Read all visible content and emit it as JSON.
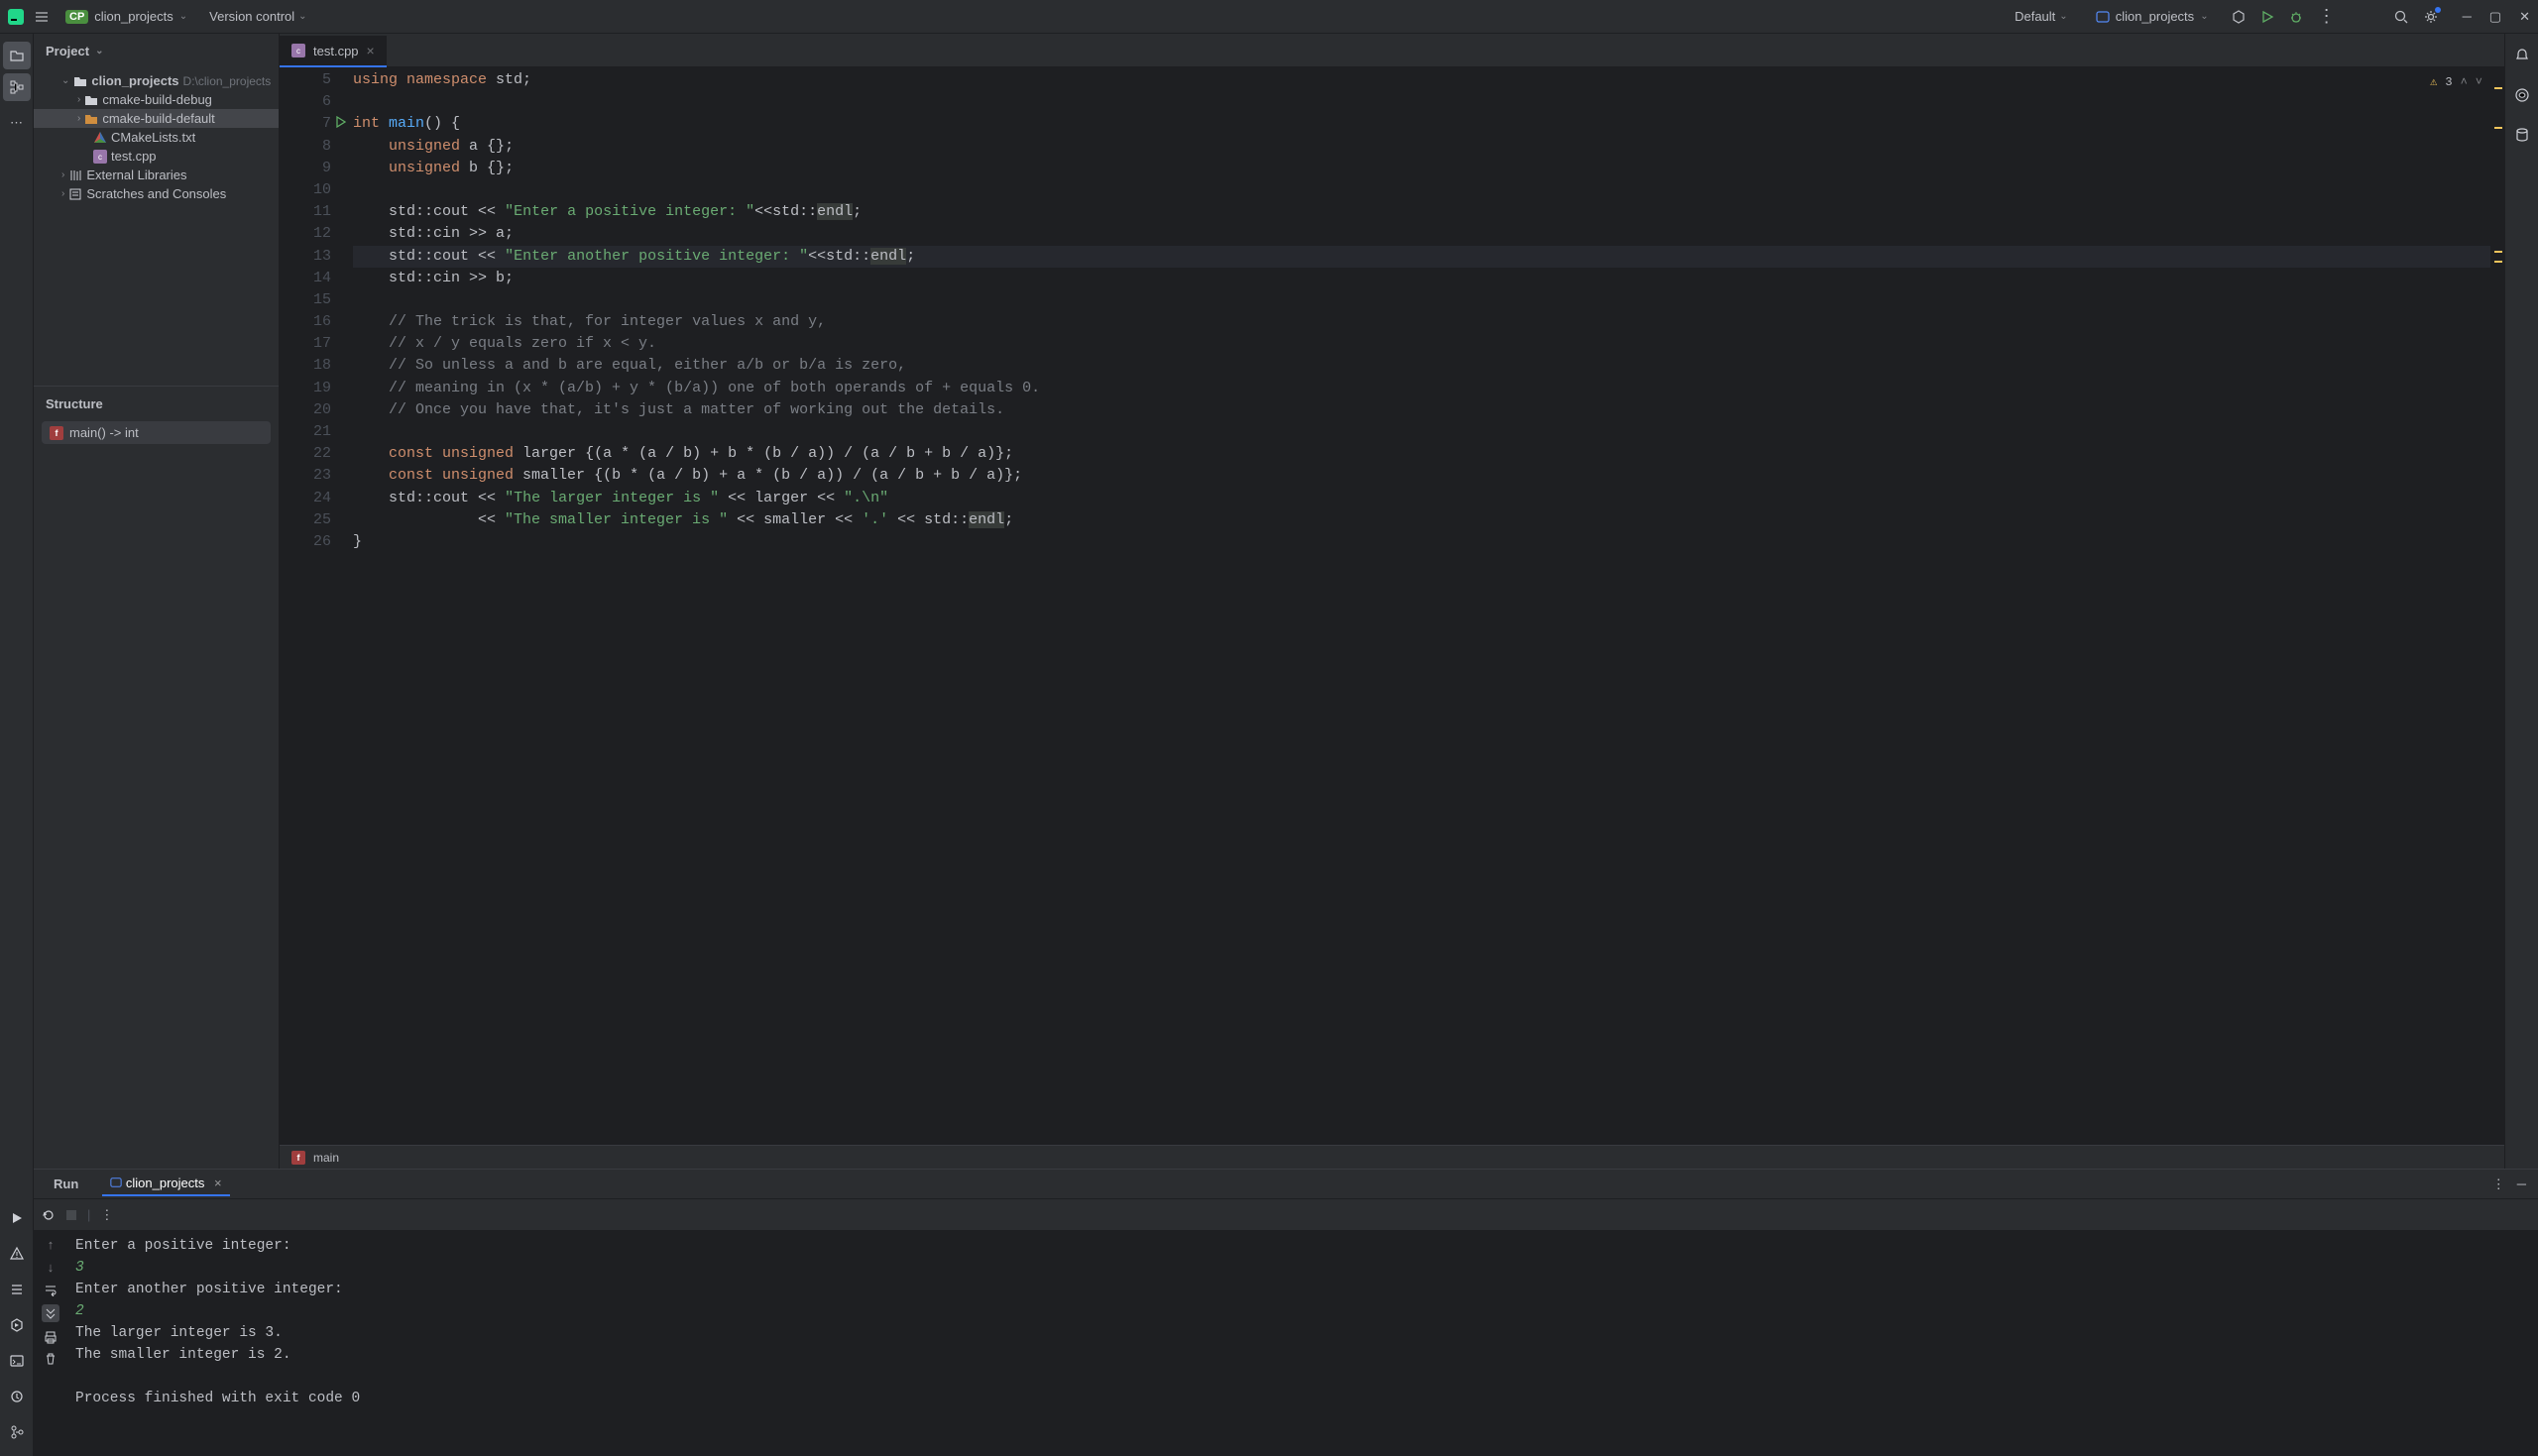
{
  "titlebar": {
    "project_name": "clion_projects",
    "vcs_label": "Version control",
    "default_label": "Default",
    "run_config": "clion_projects"
  },
  "sidebar": {
    "header": "Project",
    "root": {
      "name": "clion_projects",
      "path": "D:\\clion_projects"
    },
    "children": [
      {
        "name": "cmake-build-debug"
      },
      {
        "name": "cmake-build-default"
      },
      {
        "name": "CMakeLists.txt"
      },
      {
        "name": "test.cpp"
      }
    ],
    "external": "External Libraries",
    "scratches": "Scratches and Consoles"
  },
  "structure": {
    "header": "Structure",
    "item": "main() -> int"
  },
  "tabs": {
    "active": "test.cpp"
  },
  "inspection": {
    "warnings": "3"
  },
  "code_lines": [
    {
      "n": 5,
      "seg": [
        {
          "t": "using ",
          "c": "kw"
        },
        {
          "t": "namespace ",
          "c": "kw"
        },
        {
          "t": "std",
          "c": ""
        },
        {
          "t": ";",
          "c": ""
        }
      ]
    },
    {
      "n": 6,
      "seg": []
    },
    {
      "n": 7,
      "run": true,
      "seg": [
        {
          "t": "int ",
          "c": "kw"
        },
        {
          "t": "main",
          "c": "fn"
        },
        {
          "t": "() {",
          "c": ""
        }
      ]
    },
    {
      "n": 8,
      "seg": [
        {
          "t": "    ",
          "c": ""
        },
        {
          "t": "unsigned ",
          "c": "kw"
        },
        {
          "t": "a ",
          "c": ""
        },
        {
          "t": "{}",
          "c": ""
        },
        {
          "t": ";",
          "c": ""
        }
      ]
    },
    {
      "n": 9,
      "seg": [
        {
          "t": "    ",
          "c": ""
        },
        {
          "t": "unsigned ",
          "c": "kw"
        },
        {
          "t": "b ",
          "c": ""
        },
        {
          "t": "{}",
          "c": ""
        },
        {
          "t": ";",
          "c": ""
        }
      ]
    },
    {
      "n": 10,
      "seg": []
    },
    {
      "n": 11,
      "seg": [
        {
          "t": "    ",
          "c": ""
        },
        {
          "t": "std",
          "c": "ns"
        },
        {
          "t": "::",
          "c": ""
        },
        {
          "t": "cout << ",
          "c": ""
        },
        {
          "t": "\"Enter a positive integer: \"",
          "c": "str"
        },
        {
          "t": "<<",
          "c": ""
        },
        {
          "t": "std",
          "c": "ns"
        },
        {
          "t": "::",
          "c": ""
        },
        {
          "t": "endl",
          "c": "",
          "hl": true
        },
        {
          "t": ";",
          "c": ""
        }
      ]
    },
    {
      "n": 12,
      "seg": [
        {
          "t": "    ",
          "c": ""
        },
        {
          "t": "std",
          "c": "ns"
        },
        {
          "t": "::",
          "c": ""
        },
        {
          "t": "cin >> a;",
          "c": ""
        }
      ]
    },
    {
      "n": 13,
      "hl": true,
      "seg": [
        {
          "t": "    ",
          "c": ""
        },
        {
          "t": "std",
          "c": "ns"
        },
        {
          "t": "::",
          "c": ""
        },
        {
          "t": "cout << ",
          "c": ""
        },
        {
          "t": "\"Enter another positive integer: \"",
          "c": "str"
        },
        {
          "t": "<<",
          "c": ""
        },
        {
          "t": "std",
          "c": "ns"
        },
        {
          "t": "::",
          "c": ""
        },
        {
          "t": "endl",
          "c": "",
          "hl": true
        },
        {
          "t": ";",
          "c": ""
        }
      ]
    },
    {
      "n": 14,
      "seg": [
        {
          "t": "    ",
          "c": ""
        },
        {
          "t": "std",
          "c": "ns"
        },
        {
          "t": "::",
          "c": ""
        },
        {
          "t": "cin >> b;",
          "c": ""
        }
      ]
    },
    {
      "n": 15,
      "seg": []
    },
    {
      "n": 16,
      "seg": [
        {
          "t": "    ",
          "c": ""
        },
        {
          "t": "// The trick is that, for integer values x and y,",
          "c": "cmt"
        }
      ]
    },
    {
      "n": 17,
      "seg": [
        {
          "t": "    ",
          "c": ""
        },
        {
          "t": "// x / y equals zero if x < y.",
          "c": "cmt"
        }
      ]
    },
    {
      "n": 18,
      "seg": [
        {
          "t": "    ",
          "c": ""
        },
        {
          "t": "// So unless a and b are equal, either a/b or b/a is zero,",
          "c": "cmt"
        }
      ]
    },
    {
      "n": 19,
      "seg": [
        {
          "t": "    ",
          "c": ""
        },
        {
          "t": "// meaning in (x * (a/b) + y * (b/a)) one of both operands of + equals 0.",
          "c": "cmt"
        }
      ]
    },
    {
      "n": 20,
      "seg": [
        {
          "t": "    ",
          "c": ""
        },
        {
          "t": "// Once you have that, it's just a matter of working out the details.",
          "c": "cmt"
        }
      ]
    },
    {
      "n": 21,
      "seg": []
    },
    {
      "n": 22,
      "seg": [
        {
          "t": "    ",
          "c": ""
        },
        {
          "t": "const unsigned ",
          "c": "kw"
        },
        {
          "t": "larger ",
          "c": ""
        },
        {
          "t": "{(a * (a / b) + b * (b / a)) / (a / b + b / a)};",
          "c": ""
        }
      ]
    },
    {
      "n": 23,
      "seg": [
        {
          "t": "    ",
          "c": ""
        },
        {
          "t": "const unsigned ",
          "c": "kw"
        },
        {
          "t": "smaller ",
          "c": ""
        },
        {
          "t": "{(b * (a / b) + a * (b / a)) / (a / b + b / a)};",
          "c": ""
        }
      ]
    },
    {
      "n": 24,
      "seg": [
        {
          "t": "    ",
          "c": ""
        },
        {
          "t": "std",
          "c": "ns"
        },
        {
          "t": "::",
          "c": ""
        },
        {
          "t": "cout << ",
          "c": ""
        },
        {
          "t": "\"The larger integer is \"",
          "c": "str"
        },
        {
          "t": " << larger << ",
          "c": ""
        },
        {
          "t": "\".\\n\"",
          "c": "str"
        }
      ]
    },
    {
      "n": 25,
      "seg": [
        {
          "t": "              << ",
          "c": ""
        },
        {
          "t": "\"The smaller integer is \"",
          "c": "str"
        },
        {
          "t": " << smaller << ",
          "c": ""
        },
        {
          "t": "'.'",
          "c": "str"
        },
        {
          "t": " << ",
          "c": ""
        },
        {
          "t": "std",
          "c": "ns"
        },
        {
          "t": "::",
          "c": ""
        },
        {
          "t": "endl",
          "c": "",
          "hl": true
        },
        {
          "t": ";",
          "c": ""
        }
      ]
    },
    {
      "n": 26,
      "seg": [
        {
          "t": "}",
          "c": ""
        }
      ]
    }
  ],
  "breadcrumb": {
    "item": "main"
  },
  "run": {
    "tab_label": "Run",
    "config_name": "clion_projects",
    "console": [
      {
        "t": "Enter a positive integer: ",
        "c": ""
      },
      {
        "t": "3",
        "c": "input-val"
      },
      {
        "t": "Enter another positive integer: ",
        "c": ""
      },
      {
        "t": "2",
        "c": "input-val"
      },
      {
        "t": "The larger integer is 3.",
        "c": ""
      },
      {
        "t": "The smaller integer is 2.",
        "c": ""
      },
      {
        "t": "",
        "c": ""
      },
      {
        "t": "Process finished with exit code 0",
        "c": ""
      }
    ]
  }
}
